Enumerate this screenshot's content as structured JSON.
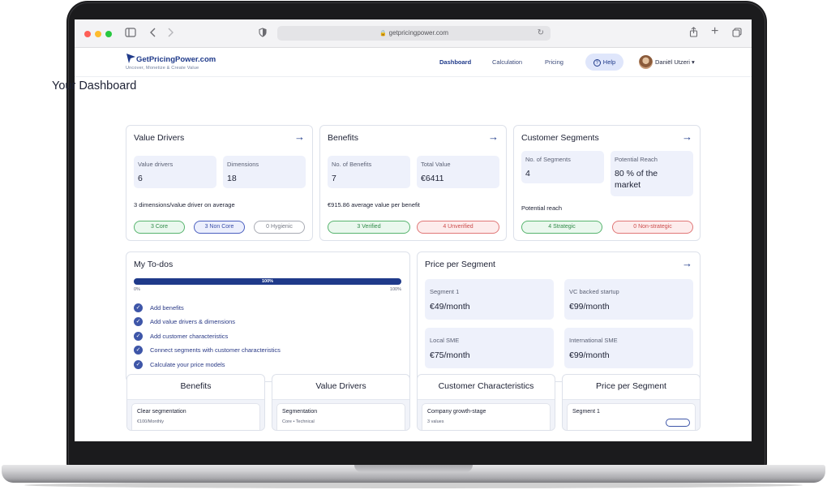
{
  "browser": {
    "url": "getpricingpower.com"
  },
  "brand": {
    "name": "GetPricingPower.com",
    "tagline": "Uncover, Monetize & Create Value",
    "color": "#1f3a8a"
  },
  "nav": {
    "links": [
      "Dashboard",
      "Calculation",
      "Pricing"
    ],
    "help": "Help",
    "user": "Daniël Utzeri ▾"
  },
  "page": {
    "title": "Your Dashboard"
  },
  "value_drivers": {
    "title": "Value Drivers",
    "stats": [
      {
        "label": "Value drivers",
        "value": "6"
      },
      {
        "label": "Dimensions",
        "value": "18"
      }
    ],
    "note": "3 dimensions/value driver on average",
    "pills": [
      "3 Core",
      "3 Non Core",
      "0 Hygienic"
    ]
  },
  "benefits": {
    "title": "Benefits",
    "stats": [
      {
        "label": "No. of Benefits",
        "value": "7"
      },
      {
        "label": "Total Value",
        "value": "€6411"
      }
    ],
    "note": "€915.86 average value per benefit",
    "pills": [
      "3 Verified",
      "4 Unverified"
    ]
  },
  "customer_segments": {
    "title": "Customer Segments",
    "stats": [
      {
        "label": "No. of Segments",
        "value": "4"
      },
      {
        "label": "Potential Reach",
        "value": "80 % of the market"
      }
    ],
    "note": "Potential reach",
    "pills": [
      "4 Strategic",
      "0 Non-strategic"
    ]
  },
  "todos": {
    "title": "My To-dos",
    "progress": 100,
    "progress_label": "100%",
    "scale_min": "0%",
    "scale_max": "100%",
    "items": [
      "Add benefits",
      "Add value drivers & dimensions",
      "Add customer characteristics",
      "Connect segments with customer characteristics",
      "Calculate your price models"
    ]
  },
  "price_per_segment": {
    "title": "Price per Segment",
    "segments": [
      {
        "name": "Segment 1",
        "price": "€49/month"
      },
      {
        "name": "VC backed startup",
        "price": "€99/month"
      },
      {
        "name": "Local SME",
        "price": "€75/month"
      },
      {
        "name": "International SME",
        "price": "€99/month"
      }
    ]
  },
  "bottom_cards": [
    {
      "title": "Benefits",
      "item": "Clear segmentation",
      "sub": "€100/Monthly"
    },
    {
      "title": "Value Drivers",
      "item": "Segmentation",
      "sub": "Core • Technical"
    },
    {
      "title": "Customer Characteristics",
      "item": "Company growth-stage",
      "sub": "3 values"
    },
    {
      "title": "Price per Segment",
      "item": "Segment 1",
      "sub": ""
    }
  ]
}
